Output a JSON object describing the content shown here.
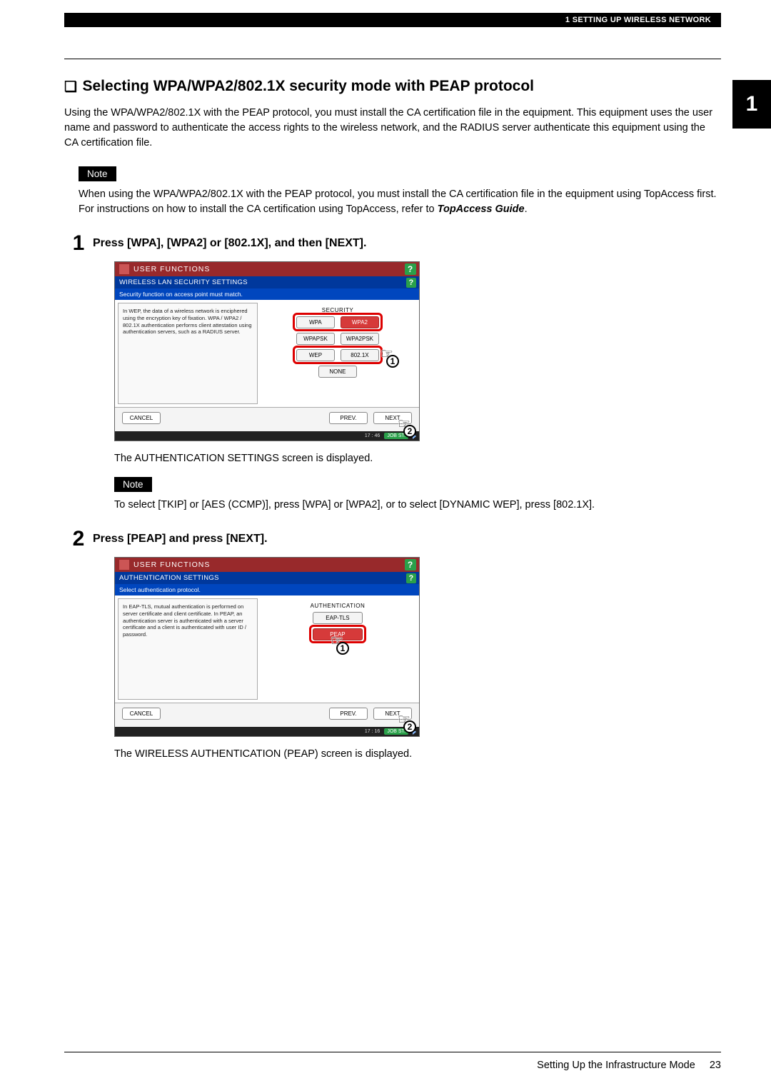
{
  "header": {
    "breadcrumb": "1 SETTING UP WIRELESS NETWORK",
    "chapter_tab": "1"
  },
  "section": {
    "title": "Selecting WPA/WPA2/802.1X security mode with PEAP protocol",
    "intro": "Using the WPA/WPA2/802.1X with the PEAP protocol, you must install the CA certification file in the equipment. This equipment uses the user name and password to authenticate the access rights to the wireless network, and the RADIUS server authenticate this equipment using the CA certification file."
  },
  "note1": {
    "label": "Note",
    "body_a": "When using the WPA/WPA2/802.1X with the PEAP protocol, you must install the CA certification file in the equipment using TopAccess first. For instructions on how to install the CA certification using TopAccess, refer to ",
    "body_b": "TopAccess Guide",
    "body_c": "."
  },
  "step1": {
    "num": "1",
    "title": "Press [WPA], [WPA2] or [802.1X], and then [NEXT].",
    "caption": "The AUTHENTICATION SETTINGS screen is displayed.",
    "screen": {
      "title": "USER FUNCTIONS",
      "subtitle": "WIRELESS LAN SECURITY SETTINGS",
      "instruction": "Security function on access point must match.",
      "leftbox": "In WEP, the data of a wireless network is enciphered using the encryption key of fixation. WPA / WPA2 / 802.1X authentication performs client attestation using authentication servers, such as a RADIUS server.",
      "group_label": "SECURITY",
      "opts": {
        "wpa": "WPA",
        "wpa2": "WPA2",
        "wpapsk": "WPAPSK",
        "wpa2psk": "WPA2PSK",
        "wep": "WEP",
        "x8021": "802.1X",
        "none": "NONE"
      },
      "nav": {
        "cancel": "CANCEL",
        "prev": "PREV.",
        "next": "NEXT"
      },
      "status": {
        "time": "17 : 46",
        "job": "JOB ST."
      }
    }
  },
  "note2": {
    "label": "Note",
    "body": "To select [TKIP] or [AES (CCMP)], press [WPA] or [WPA2], or to select [DYNAMIC WEP], press [802.1X]."
  },
  "step2": {
    "num": "2",
    "title": "Press [PEAP] and press [NEXT].",
    "caption": "The WIRELESS AUTHENTICATION (PEAP) screen is displayed.",
    "screen": {
      "title": "USER FUNCTIONS",
      "subtitle": "AUTHENTICATION SETTINGS",
      "instruction": "Select authentication protocol.",
      "leftbox": "In EAP-TLS, mutual authentication is performed on server certificate and client certificate. In PEAP, an authentication server is authenticated with a server certificate and a client is authenticated with user ID / password.",
      "group_label": "AUTHENTICATION",
      "opts": {
        "eaptls": "EAP-TLS",
        "peap": "PEAP"
      },
      "nav": {
        "cancel": "CANCEL",
        "prev": "PREV.",
        "next": "NEXT"
      },
      "status": {
        "time": "17 : 16",
        "job": "JOB ST."
      }
    }
  },
  "footer": {
    "text": "Setting Up the Infrastructure Mode",
    "page": "23"
  }
}
